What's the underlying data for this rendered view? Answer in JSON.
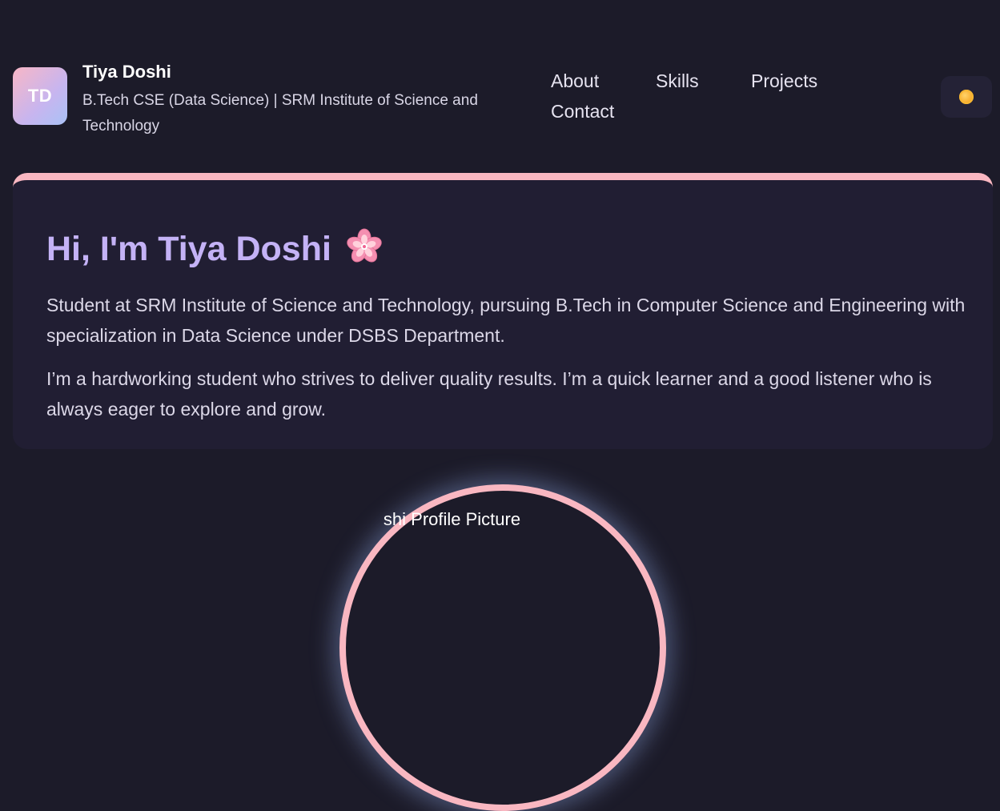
{
  "header": {
    "logo_initials": "TD",
    "name": "Tiya Doshi",
    "subtitle": "B.Tech CSE (Data Science) | SRM Institute of Science and Technology"
  },
  "nav": {
    "items": [
      {
        "label": "About"
      },
      {
        "label": "Skills"
      },
      {
        "label": "Projects"
      },
      {
        "label": "Contact"
      }
    ]
  },
  "theme_toggle": {
    "icon": "sun-icon"
  },
  "hero": {
    "title": "Hi, I'm Tiya Doshi",
    "title_icon": "cherry-blossom-icon",
    "paragraph1": "Student at SRM Institute of Science and Technology, pursuing B.Tech in Computer Science and Engineering with specialization in Data Science under DSBS Department.",
    "paragraph2": "I’m a hardworking student who strives to deliver quality results. I’m a quick learner and a good listener who is always eager to explore and grow."
  },
  "profile": {
    "alt_text_visible": "shi Profile Picture"
  },
  "colors": {
    "background": "#1c1b29",
    "card": "#211e33",
    "accent_pink": "#f9b7c1",
    "title_purple": "#c4b2f6"
  }
}
